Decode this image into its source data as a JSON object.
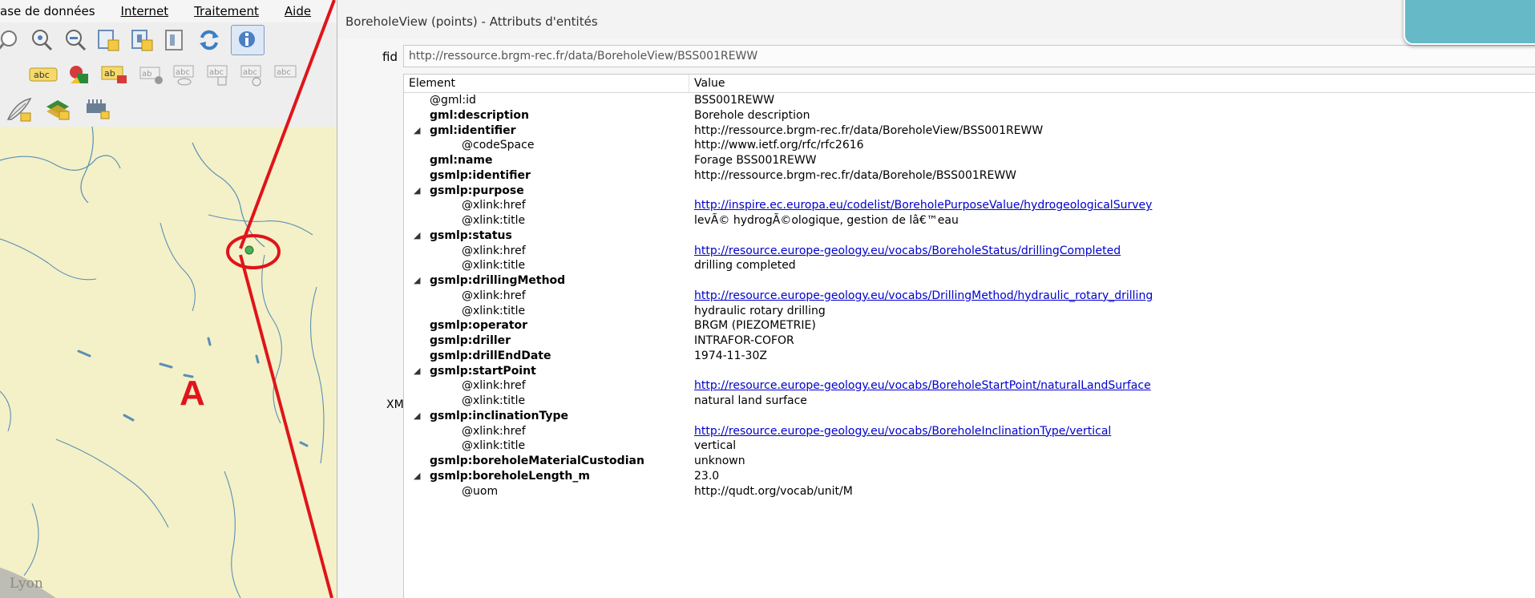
{
  "menubar": {
    "items": [
      {
        "label": "ase de données"
      },
      {
        "label": "Internet"
      },
      {
        "label": "Traitement"
      },
      {
        "label": "Aide"
      }
    ]
  },
  "toolbars": {
    "row1_icons": [
      "pan-map-icon",
      "zoom-in-icon",
      "zoom-out-icon",
      "zoom-layer-icon",
      "zoom-selection-icon",
      "zoom-last-icon",
      "refresh-icon",
      "identify-features-icon"
    ],
    "row2_icons": [
      "label-icon",
      "layer-diagram-icon",
      "label-highlight-icon",
      "pin-labels-icon",
      "show-hide-labels-icon",
      "move-label-icon",
      "rotate-label-icon",
      "change-label-icon"
    ],
    "row3_icons": [
      "digitize-feather-icon",
      "add-vector-layer-icon",
      "add-raster-layer-icon"
    ]
  },
  "map": {
    "annotation_label": "A",
    "city_label": "Lyon",
    "colors": {
      "land": "#f4f1c8",
      "river": "#5b8fb5",
      "marker": "#4caf50",
      "annotation": "#e0141a"
    }
  },
  "dialog": {
    "title": "BoreholeView (points) - Attributs d'entités",
    "fid_label": "fid",
    "fid_value": "http://ressource.brgm-rec.fr/data/BoreholeView/BSS001REWW",
    "xml_label": "XML",
    "columns": {
      "element": "Element",
      "value": "Value"
    },
    "rows": [
      {
        "element": "@gml:id",
        "value": "BSS001REWW",
        "level": 0,
        "bold": false,
        "expanded": false,
        "link": false
      },
      {
        "element": "gml:description",
        "value": "Borehole description",
        "level": 0,
        "bold": true,
        "expanded": false,
        "link": false
      },
      {
        "element": "gml:identifier",
        "value": "http://ressource.brgm-rec.fr/data/BoreholeView/BSS001REWW",
        "level": 0,
        "bold": true,
        "expanded": true,
        "link": false
      },
      {
        "element": "@codeSpace",
        "value": "http://www.ietf.org/rfc/rfc2616",
        "level": 1,
        "bold": false,
        "expanded": false,
        "link": false
      },
      {
        "element": "gml:name",
        "value": "Forage BSS001REWW",
        "level": 0,
        "bold": true,
        "expanded": false,
        "link": false
      },
      {
        "element": "gsmlp:identifier",
        "value": "http://ressource.brgm-rec.fr/data/Borehole/BSS001REWW",
        "level": 0,
        "bold": true,
        "expanded": false,
        "link": false
      },
      {
        "element": "gsmlp:purpose",
        "value": "",
        "level": 0,
        "bold": true,
        "expanded": true,
        "link": false
      },
      {
        "element": "@xlink:href",
        "value": "http://inspire.ec.europa.eu/codelist/BoreholePurposeValue/hydrogeologicalSurvey",
        "level": 1,
        "bold": false,
        "expanded": false,
        "link": true
      },
      {
        "element": "@xlink:title",
        "value": "levÃ© hydrogÃ©ologique, gestion de lâ€™eau",
        "level": 1,
        "bold": false,
        "expanded": false,
        "link": false
      },
      {
        "element": "gsmlp:status",
        "value": "",
        "level": 0,
        "bold": true,
        "expanded": true,
        "link": false
      },
      {
        "element": "@xlink:href",
        "value": "http://resource.europe-geology.eu/vocabs/BoreholeStatus/drillingCompleted",
        "level": 1,
        "bold": false,
        "expanded": false,
        "link": true
      },
      {
        "element": "@xlink:title",
        "value": "drilling completed",
        "level": 1,
        "bold": false,
        "expanded": false,
        "link": false
      },
      {
        "element": "gsmlp:drillingMethod",
        "value": "",
        "level": 0,
        "bold": true,
        "expanded": true,
        "link": false
      },
      {
        "element": "@xlink:href",
        "value": "http://resource.europe-geology.eu/vocabs/DrillingMethod/hydraulic_rotary_drilling",
        "level": 1,
        "bold": false,
        "expanded": false,
        "link": true
      },
      {
        "element": "@xlink:title",
        "value": "hydraulic rotary drilling",
        "level": 1,
        "bold": false,
        "expanded": false,
        "link": false
      },
      {
        "element": "gsmlp:operator",
        "value": "BRGM (PIEZOMETRIE)",
        "level": 0,
        "bold": true,
        "expanded": false,
        "link": false
      },
      {
        "element": "gsmlp:driller",
        "value": "INTRAFOR-COFOR",
        "level": 0,
        "bold": true,
        "expanded": false,
        "link": false
      },
      {
        "element": "gsmlp:drillEndDate",
        "value": "1974-11-30Z",
        "level": 0,
        "bold": true,
        "expanded": false,
        "link": false
      },
      {
        "element": "gsmlp:startPoint",
        "value": "",
        "level": 0,
        "bold": true,
        "expanded": true,
        "link": false
      },
      {
        "element": "@xlink:href",
        "value": "http://resource.europe-geology.eu/vocabs/BoreholeStartPoint/naturalLandSurface",
        "level": 1,
        "bold": false,
        "expanded": false,
        "link": true
      },
      {
        "element": "@xlink:title",
        "value": "natural land surface",
        "level": 1,
        "bold": false,
        "expanded": false,
        "link": false
      },
      {
        "element": "gsmlp:inclinationType",
        "value": "",
        "level": 0,
        "bold": true,
        "expanded": true,
        "link": false
      },
      {
        "element": "@xlink:href",
        "value": "http://resource.europe-geology.eu/vocabs/BoreholeInclinationType/vertical",
        "level": 1,
        "bold": false,
        "expanded": false,
        "link": true
      },
      {
        "element": "@xlink:title",
        "value": "vertical",
        "level": 1,
        "bold": false,
        "expanded": false,
        "link": false
      },
      {
        "element": "gsmlp:boreholeMaterialCustodian",
        "value": "unknown",
        "level": 0,
        "bold": true,
        "expanded": false,
        "link": false
      },
      {
        "element": "gsmlp:boreholeLength_m",
        "value": "23.0",
        "level": 0,
        "bold": true,
        "expanded": true,
        "link": false
      },
      {
        "element": "@uom",
        "value": "http://qudt.org/vocab/unit/M",
        "level": 1,
        "bold": false,
        "expanded": false,
        "link": false
      }
    ]
  }
}
